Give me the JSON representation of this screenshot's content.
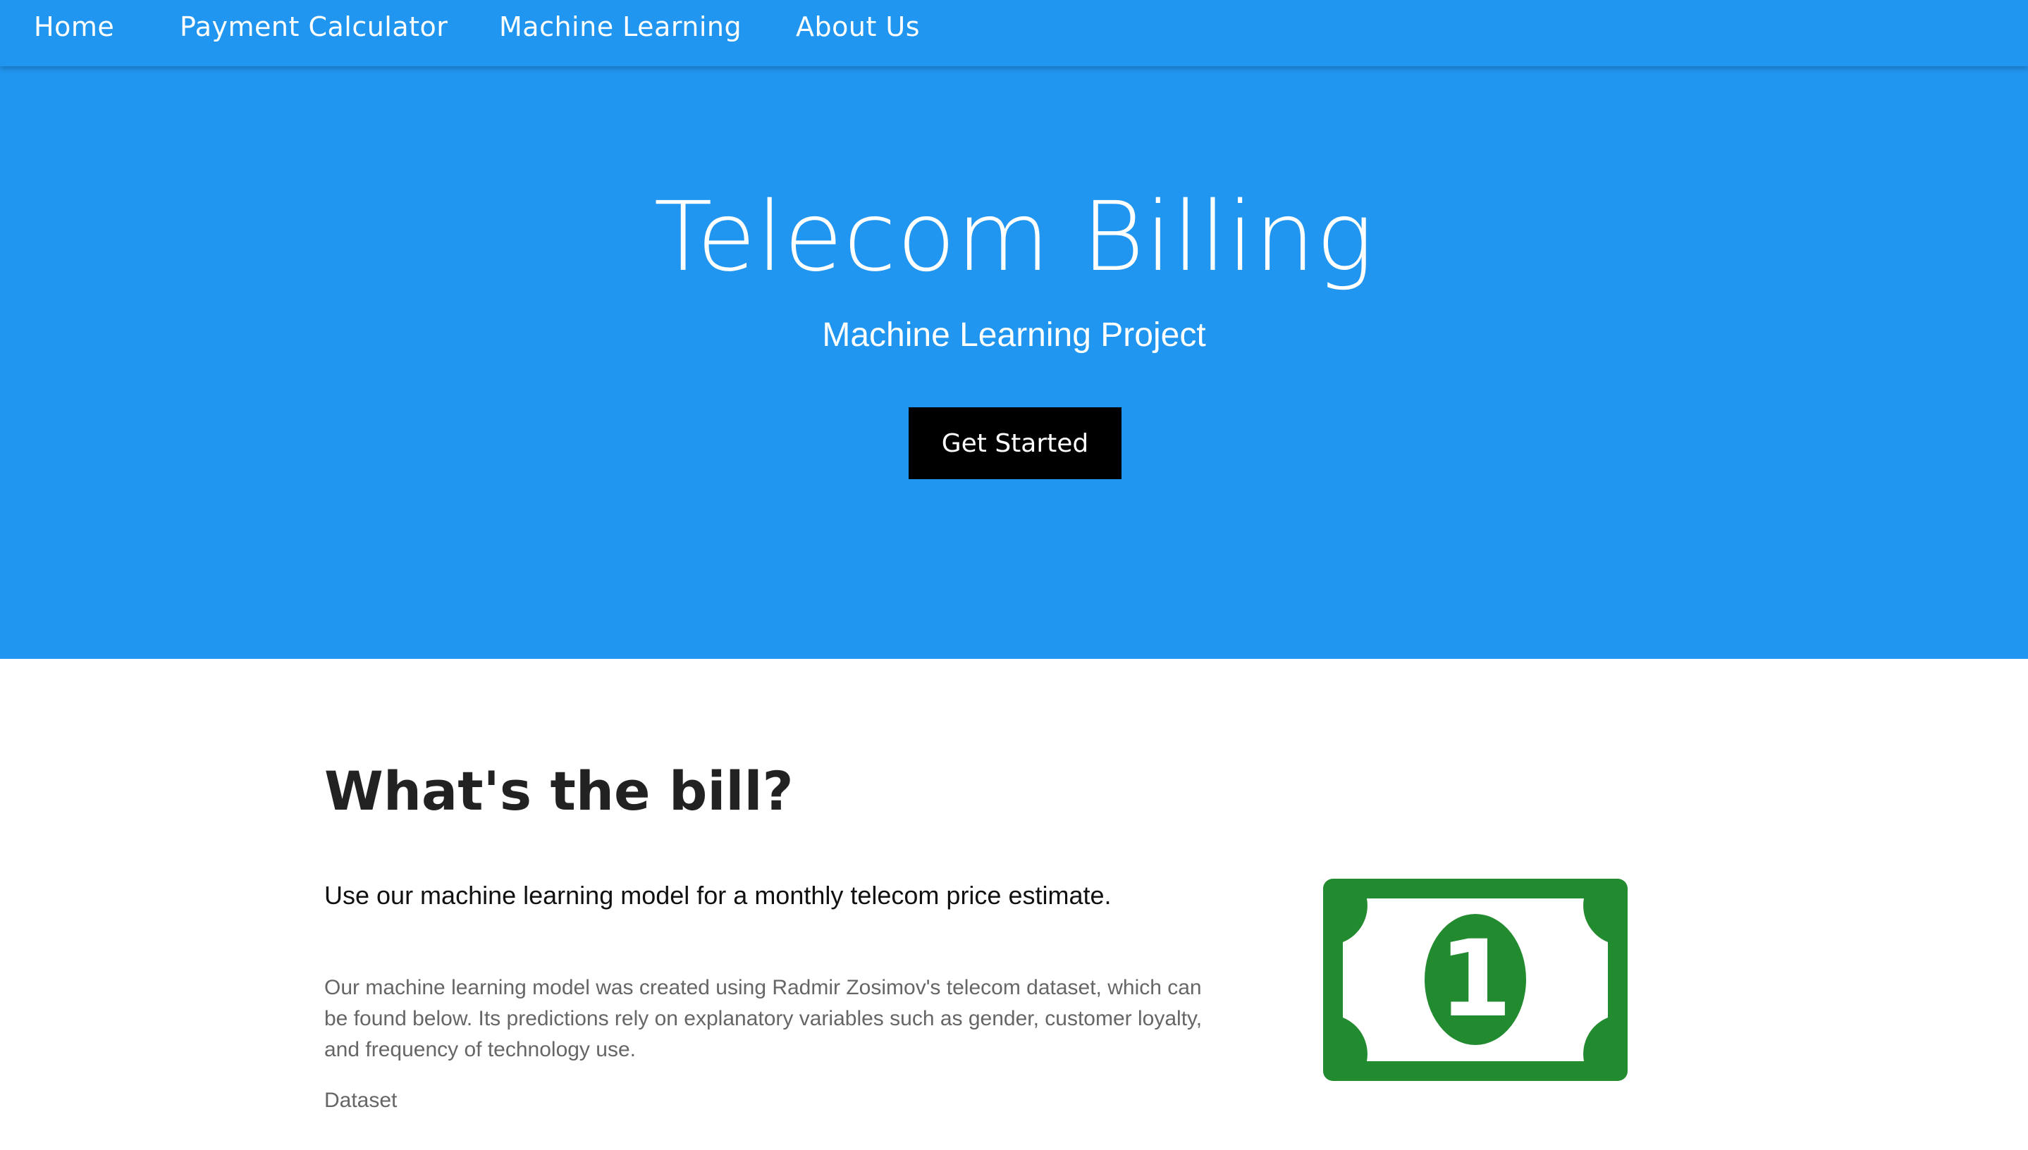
{
  "nav": {
    "items": [
      {
        "label": "Home"
      },
      {
        "label": "Payment Calculator"
      },
      {
        "label": "Machine Learning"
      },
      {
        "label": "About Us"
      }
    ]
  },
  "hero": {
    "title": "Telecom Billing",
    "subtitle": "Machine Learning Project",
    "cta_label": "Get Started"
  },
  "section": {
    "title": "What's the bill?",
    "lead": "Use our machine learning model for a monthly telecom price estimate.",
    "body": "Our machine learning model was created using Radmir Zosimov's telecom dataset, which can be found below. Its predictions rely on explanatory variables such as gender, customer loyalty, and frequency of technology use.",
    "dataset_link": "Dataset"
  },
  "bill_icon": {
    "icon": "dollar-bill-icon",
    "denomination": "1",
    "color": "#238b2f"
  },
  "colors": {
    "primary": "#2196f0",
    "button": "#000000"
  }
}
